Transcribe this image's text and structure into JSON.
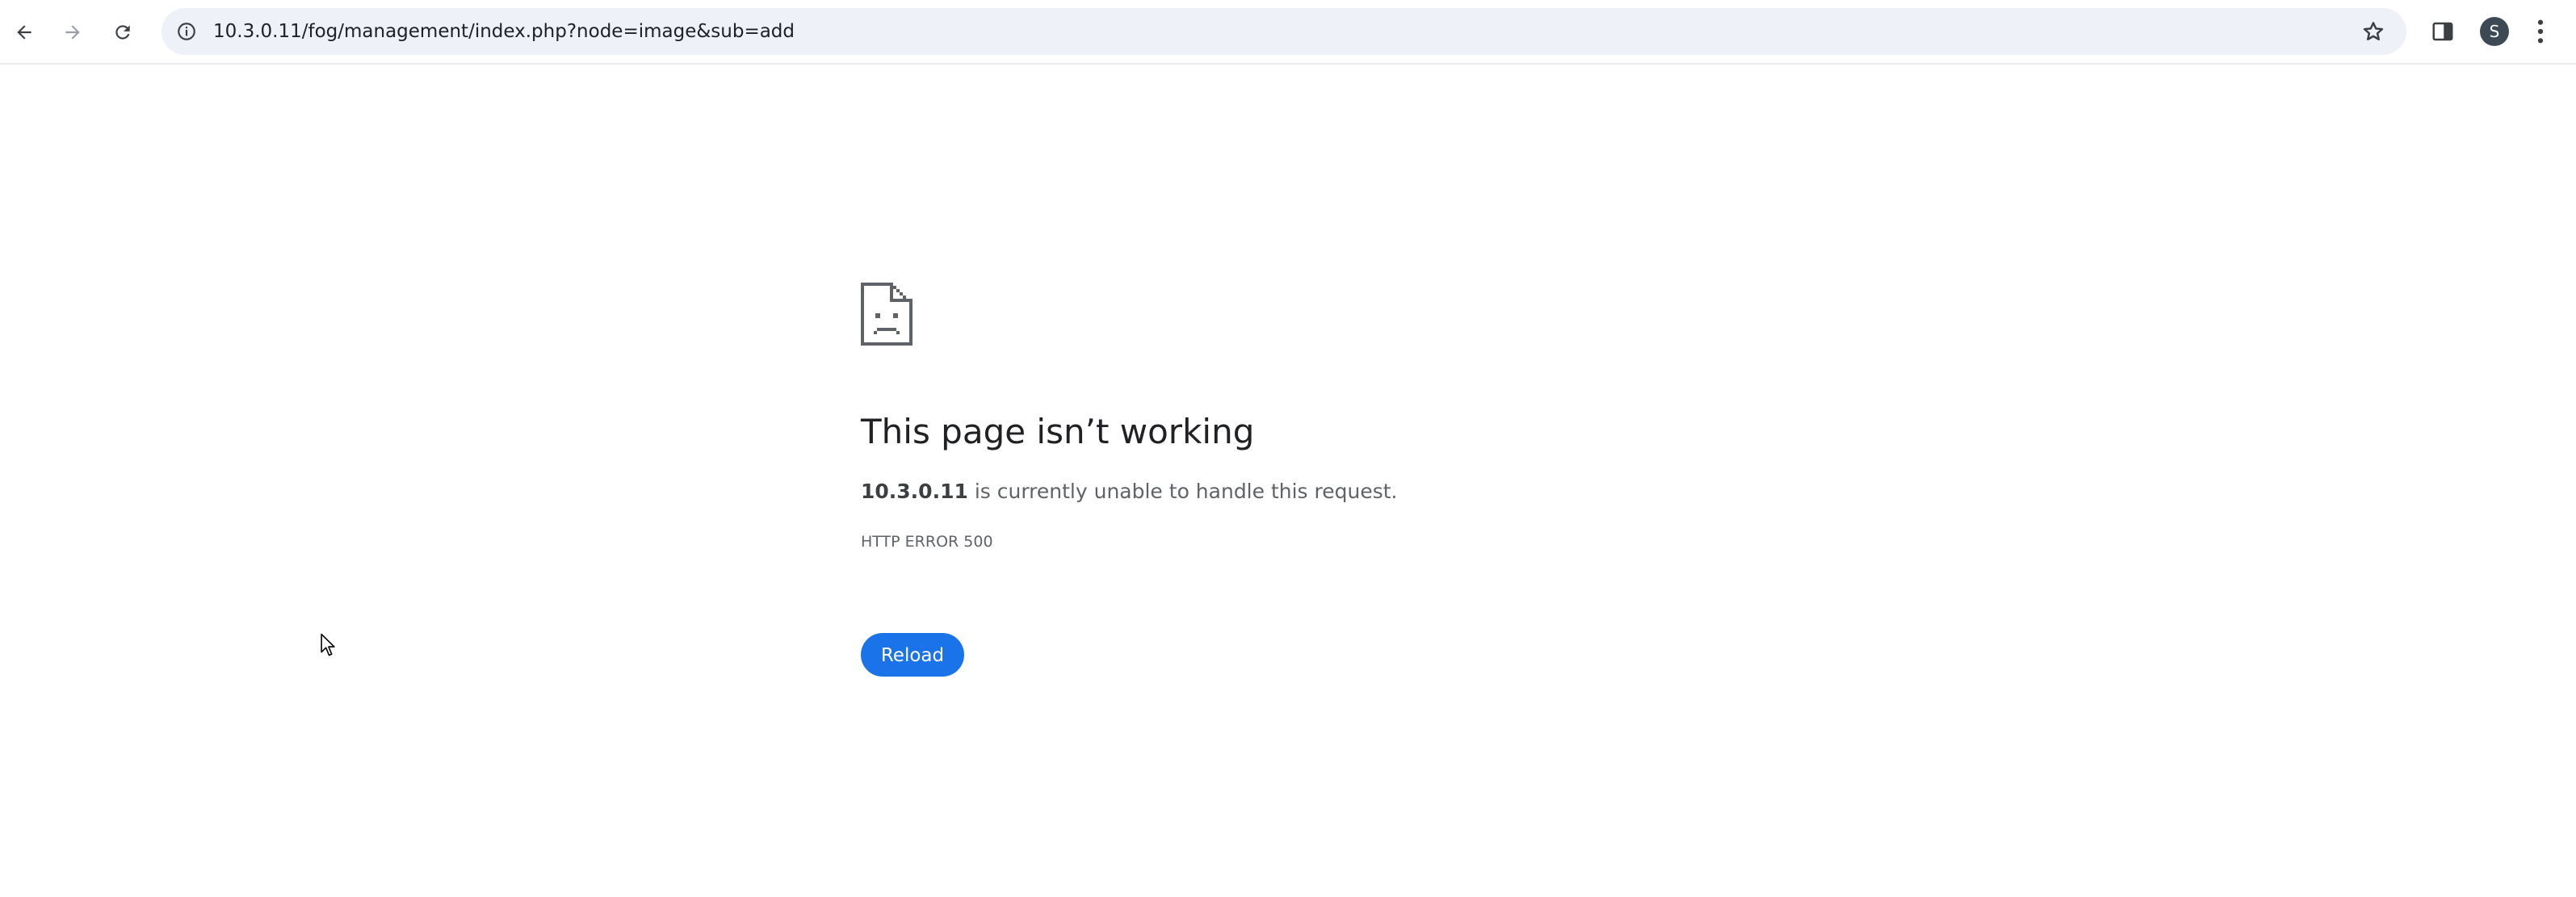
{
  "browser": {
    "url": "10.3.0.11/fog/management/index.php?node=image&sub=add",
    "profile_initial": "S",
    "icons": {
      "back": "arrow-left-icon",
      "forward": "arrow-right-icon",
      "reload": "reload-icon",
      "site_info": "info-icon",
      "bookmark": "star-icon",
      "side_panel": "side-panel-icon",
      "menu": "kebab-menu-icon"
    }
  },
  "error_page": {
    "icon": "sad-document-icon",
    "title": "This page isn’t working",
    "host": "10.3.0.11",
    "message_suffix": " is currently unable to handle this request.",
    "error_code": "HTTP ERROR 500",
    "reload_label": "Reload"
  },
  "colors": {
    "accent": "#1a73e8",
    "omnibox_bg": "#eef1f8",
    "text_primary": "#202124",
    "text_secondary": "#5f6368"
  }
}
